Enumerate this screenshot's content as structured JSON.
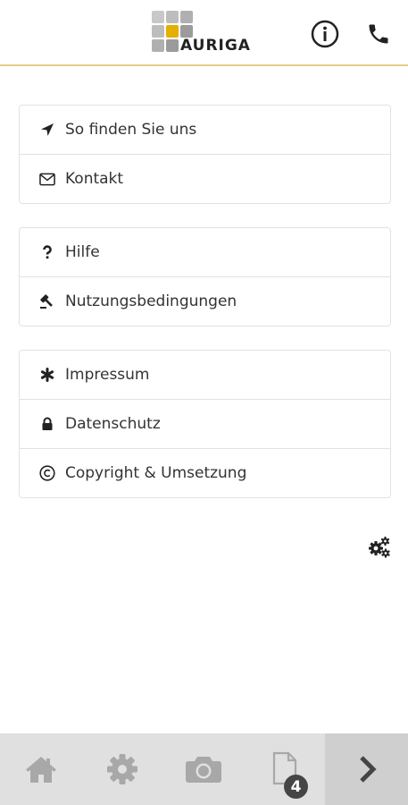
{
  "header": {
    "logo_text": "AURIGA",
    "logo_icon": "auriga-logo",
    "info_icon": "info-icon",
    "phone_icon": "phone-icon"
  },
  "menu": {
    "groups": [
      {
        "items": [
          {
            "label": "So finden Sie uns",
            "icon": "location-arrow-icon"
          },
          {
            "label": "Kontakt",
            "icon": "envelope-icon"
          }
        ]
      },
      {
        "items": [
          {
            "label": "Hilfe",
            "icon": "question-icon"
          },
          {
            "label": "Nutzungsbedingungen",
            "icon": "gavel-icon"
          }
        ]
      },
      {
        "items": [
          {
            "label": "Impressum",
            "icon": "asterisk-icon"
          },
          {
            "label": "Datenschutz",
            "icon": "lock-icon"
          },
          {
            "label": "Copyright & Umsetzung",
            "icon": "copyright-icon"
          }
        ]
      }
    ]
  },
  "settings_icon": "gears-icon",
  "bottom_nav": {
    "tabs": [
      {
        "icon": "home-icon"
      },
      {
        "icon": "gear-icon"
      },
      {
        "icon": "camera-icon"
      },
      {
        "icon": "document-icon",
        "badge": "4"
      },
      {
        "icon": "chevron-right-icon"
      }
    ]
  },
  "colors": {
    "accent": "#e3b000",
    "header_border": "#e3cf8a",
    "nav_bg": "#e0e0e0",
    "nav_icon": "#a8a8a8"
  }
}
